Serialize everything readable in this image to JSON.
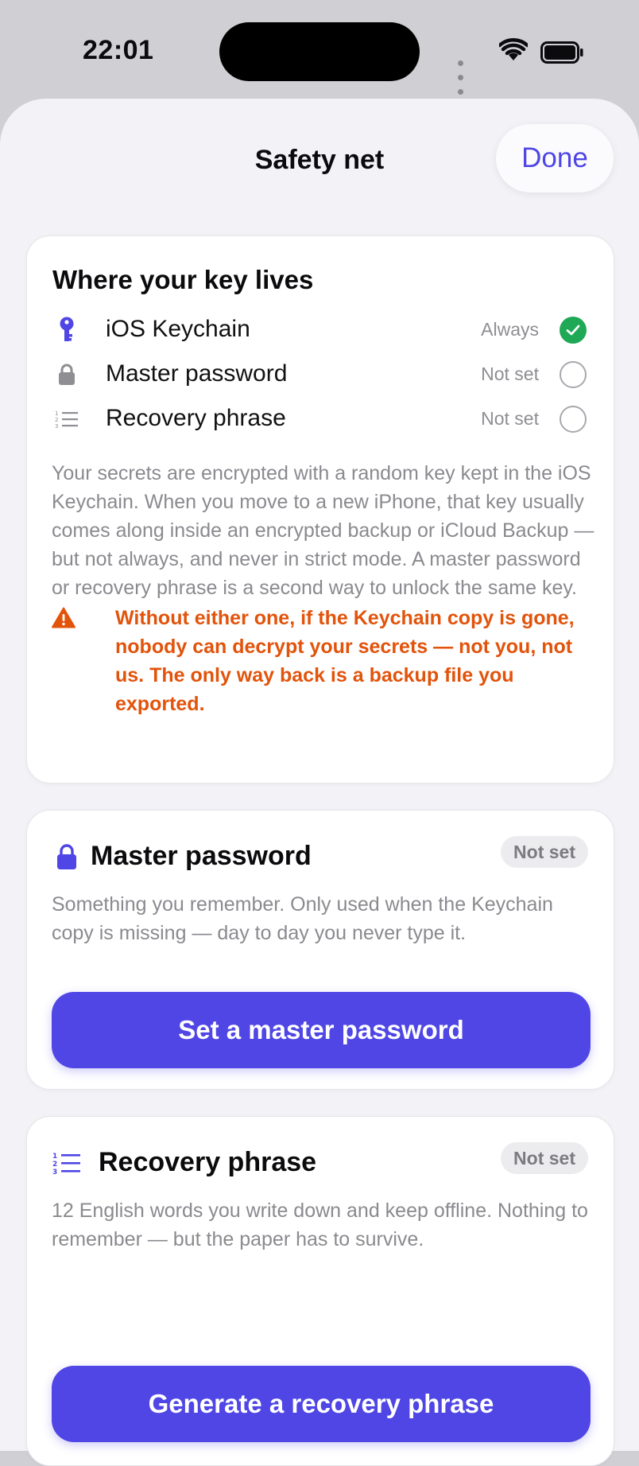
{
  "status_bar": {
    "time": "22:01"
  },
  "header": {
    "title": "Safety net",
    "done_label": "Done"
  },
  "key_card": {
    "heading": "Where your key lives",
    "rows": [
      {
        "label": "iOS Keychain",
        "status": "Always",
        "checked": true,
        "icon": "key-icon"
      },
      {
        "label": "Master password",
        "status": "Not set",
        "checked": false,
        "icon": "lock-icon"
      },
      {
        "label": "Recovery phrase",
        "status": "Not set",
        "checked": false,
        "icon": "numbered-list-icon"
      }
    ],
    "body": "Your secrets are encrypted with a random key kept in the iOS Keychain. When you move to a new iPhone, that key usually comes along inside an encrypted backup or iCloud Backup — but not always, and never in strict mode. A master password or recovery phrase is a second way to unlock the same key.",
    "warning": "Without either one, if the Keychain copy is gone, nobody can decrypt your secrets — not you, not us. The only way back is a backup file you exported."
  },
  "master_password": {
    "title": "Master password",
    "badge": "Not set",
    "body": "Something you remember. Only used when the Keychain copy is missing — day to day you never type it.",
    "button": "Set a master password"
  },
  "recovery_phrase": {
    "title": "Recovery phrase",
    "badge": "Not set",
    "body": "12 English words you write down and keep offline. Nothing to remember — but the paper has to survive.",
    "button": "Generate a recovery phrase"
  },
  "colors": {
    "accent": "#4f46e5",
    "success": "#1fa855",
    "warning": "#e2530b",
    "secondary_text": "#8a8a8f"
  }
}
